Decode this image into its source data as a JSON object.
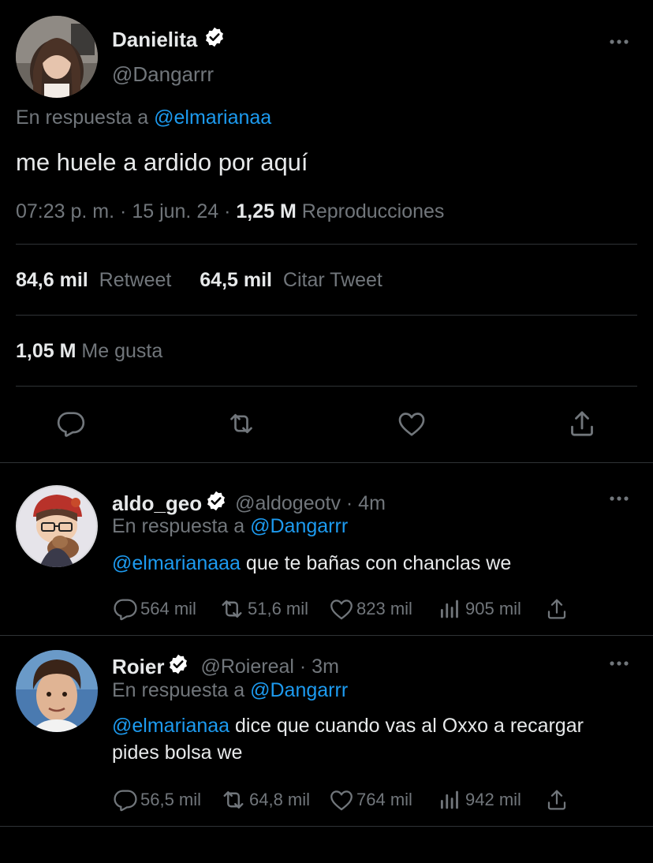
{
  "main_tweet": {
    "name": "Danielita",
    "handle": "@Dangarrr",
    "reply_prefix": "En respuesta a",
    "reply_to": "@elmarianaa",
    "text": "me huele a ardido por aquí",
    "time": "07:23 p. m.",
    "sep1": "·",
    "date": "15 jun. 24",
    "sep2": "·",
    "views": "1,25 M",
    "views_label": "Reproducciones",
    "retweets": "84,6 mil",
    "retweets_label": "Retweet",
    "quotes": "64,5 mil",
    "quotes_label": "Citar Tweet",
    "likes": "1,05 M",
    "likes_label": "Me gusta"
  },
  "replies": [
    {
      "name": "aldo_geo",
      "handle": "@aldogeotv · 4m",
      "reply_prefix": "En respuesta a",
      "reply_to": "@Dangarrr",
      "mention": "@elmarianaaa",
      "text": "que te bañas con chanclas we",
      "replies": "564 mil",
      "retweets": "51,6 mil",
      "likes": "823 mil",
      "views": "905 mil"
    },
    {
      "name": "Roier",
      "handle": "@Roiereal · 3m",
      "reply_prefix": "En respuesta a",
      "reply_to": "@Dangarrr",
      "mention": "@elmarianaa",
      "text": "dice que cuando vas al Oxxo a recargar pides bolsa we",
      "replies": "56,5 mil",
      "retweets": "64,8 mil",
      "likes": "764 mil",
      "views": "942 mil"
    }
  ],
  "colors": {
    "background": "#000000",
    "text": "#e7e9ea",
    "muted": "#71767b",
    "link": "#1d9bf0",
    "divider": "#2f3336"
  },
  "icons": [
    "verified-badge-icon",
    "more-icon",
    "reply-icon",
    "retweet-icon",
    "like-icon",
    "share-icon",
    "views-icon"
  ]
}
